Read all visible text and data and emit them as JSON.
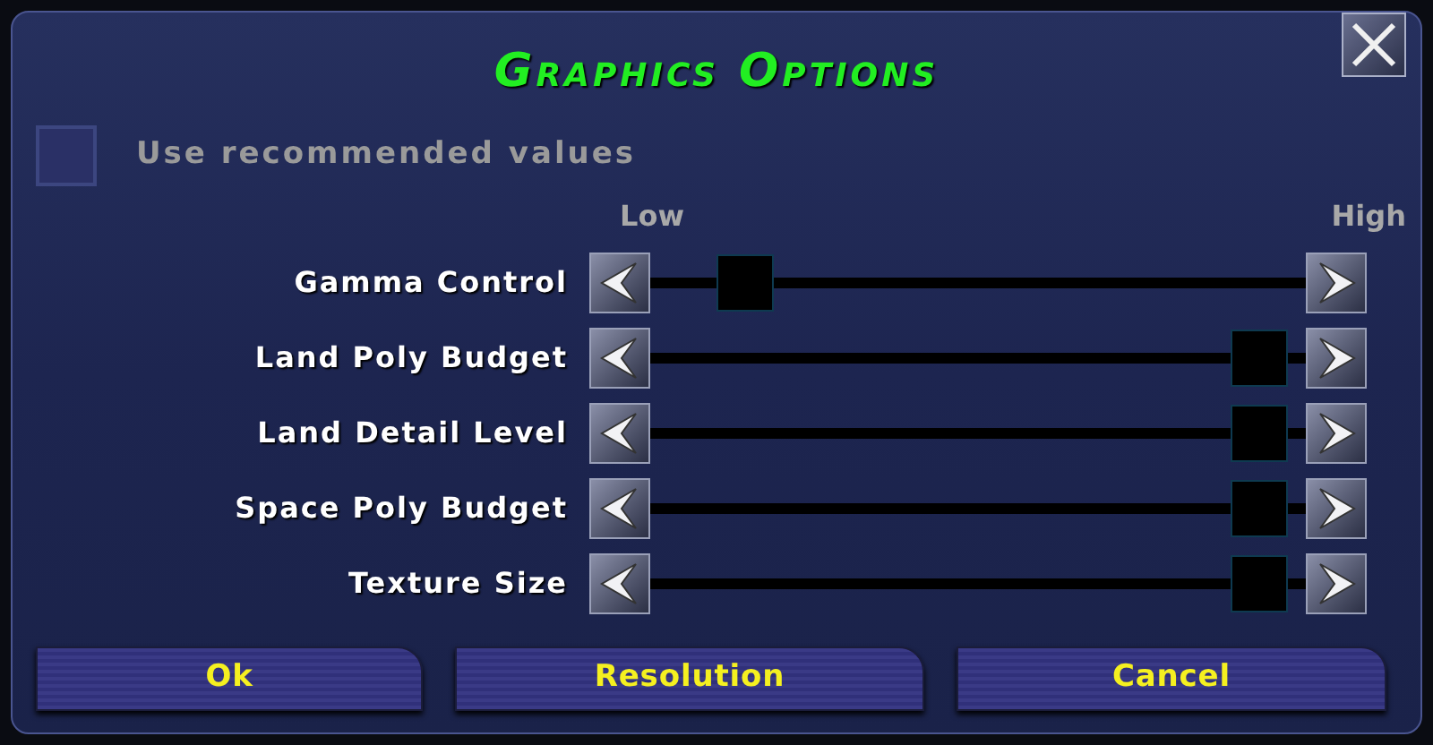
{
  "window": {
    "title": "Graphics Options"
  },
  "recommended": {
    "label": "Use recommended values",
    "checked": false
  },
  "scale": {
    "low": "Low",
    "high": "High"
  },
  "sliders": [
    {
      "name": "Gamma Control",
      "level": 0.11
    },
    {
      "name": "Land Poly Budget",
      "level": 0.97
    },
    {
      "name": "Land Detail Level",
      "level": 0.97
    },
    {
      "name": "Space Poly Budget",
      "level": 0.97
    },
    {
      "name": "Texture Size",
      "level": 0.97
    }
  ],
  "buttons": [
    "Ok",
    "Resolution",
    "Cancel"
  ]
}
